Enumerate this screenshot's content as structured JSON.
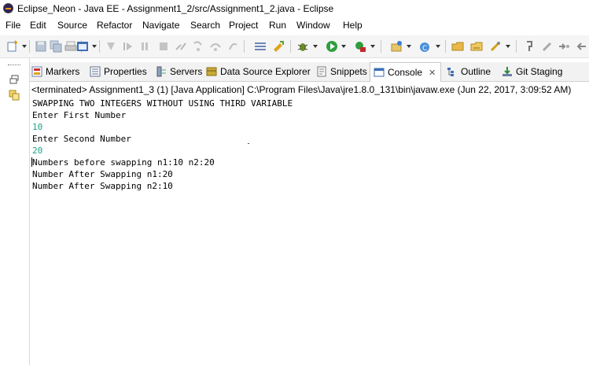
{
  "window": {
    "title": "Eclipse_Neon - Java EE - Assignment1_2/src/Assignment1_2.java - Eclipse"
  },
  "menu": {
    "items": [
      "File",
      "Edit",
      "Source",
      "Refactor",
      "Navigate",
      "Search",
      "Project",
      "Run",
      "Window",
      "Help"
    ]
  },
  "tabs": {
    "items": [
      {
        "label": "Markers",
        "icon": "markers-icon"
      },
      {
        "label": "Properties",
        "icon": "properties-icon"
      },
      {
        "label": "Servers",
        "icon": "servers-icon"
      },
      {
        "label": "Data Source Explorer",
        "icon": "data-source-icon"
      },
      {
        "label": "Snippets",
        "icon": "snippets-icon"
      },
      {
        "label": "Console",
        "icon": "console-icon",
        "active": true
      },
      {
        "label": "Outline",
        "icon": "outline-icon"
      },
      {
        "label": "Git Staging",
        "icon": "git-staging-icon"
      }
    ],
    "close_glyph": "✕"
  },
  "console": {
    "status": "<terminated> Assignment1_3 (1) [Java Application] C:\\Program Files\\Java\\jre1.8.0_131\\bin\\javaw.exe (Jun 22, 2017, 3:09:52 AM)",
    "lines": [
      {
        "text": "SWAPPING TWO INTEGERS WITHOUT USING THIRD VARIABLE",
        "kind": "output"
      },
      {
        "text": "Enter First Number",
        "kind": "output"
      },
      {
        "text": "10",
        "kind": "input"
      },
      {
        "text": "Enter Second Number",
        "kind": "output"
      },
      {
        "text": "20",
        "kind": "input"
      },
      {
        "text": "Numbers before swapping n1:10 n2:20",
        "kind": "output"
      },
      {
        "text": "Number After Swapping n1:20",
        "kind": "output"
      },
      {
        "text": "Number After Swapping n2:10",
        "kind": "output"
      }
    ],
    "input_color": "#19a186"
  }
}
